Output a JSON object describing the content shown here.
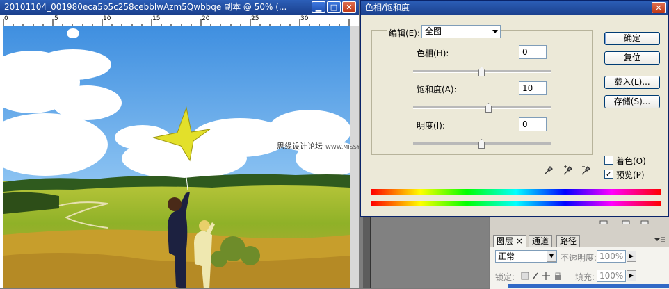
{
  "document": {
    "title": "20101104_001980eca5b5c258cebblwAzm5Qwbbqe 副本 @ 50% (...",
    "ruler_marks": [
      "0",
      "5",
      "10",
      "15",
      "20",
      "25",
      "30"
    ],
    "watermark": "思缘设计论坛",
    "watermark_url": "WWW.MISSYUAN.COM"
  },
  "dialog": {
    "title": "色相/饱和度",
    "edit_label": "编辑(E):",
    "edit_value": "全图",
    "hue_label": "色相(H):",
    "hue_value": "0",
    "hue_level": 0,
    "saturation_label": "饱和度(A):",
    "saturation_value": "10",
    "saturation_level": 10,
    "lightness_label": "明度(I):",
    "lightness_value": "0",
    "lightness_level": 0,
    "buttons": {
      "ok": "确定",
      "reset": "复位",
      "load": "载入(L)...",
      "save": "存储(S)..."
    },
    "colorize_label": "着色(O)",
    "colorize_checked": false,
    "preview_label": "预览(P)",
    "preview_checked": true,
    "check_mark": "✓"
  },
  "layers_panel": {
    "tabs": [
      "图层",
      "通道",
      "路径"
    ],
    "tab_close": "×",
    "blend_mode": "正常",
    "opacity_label": "不透明度:",
    "opacity_value": "100%",
    "lock_label": "锁定:",
    "fill_label": "填充:",
    "fill_value": "100%"
  },
  "colors": {
    "titlebar": "#1a3f8c",
    "dialog_bg": "#ece9d8",
    "accent": "#0a246a"
  }
}
